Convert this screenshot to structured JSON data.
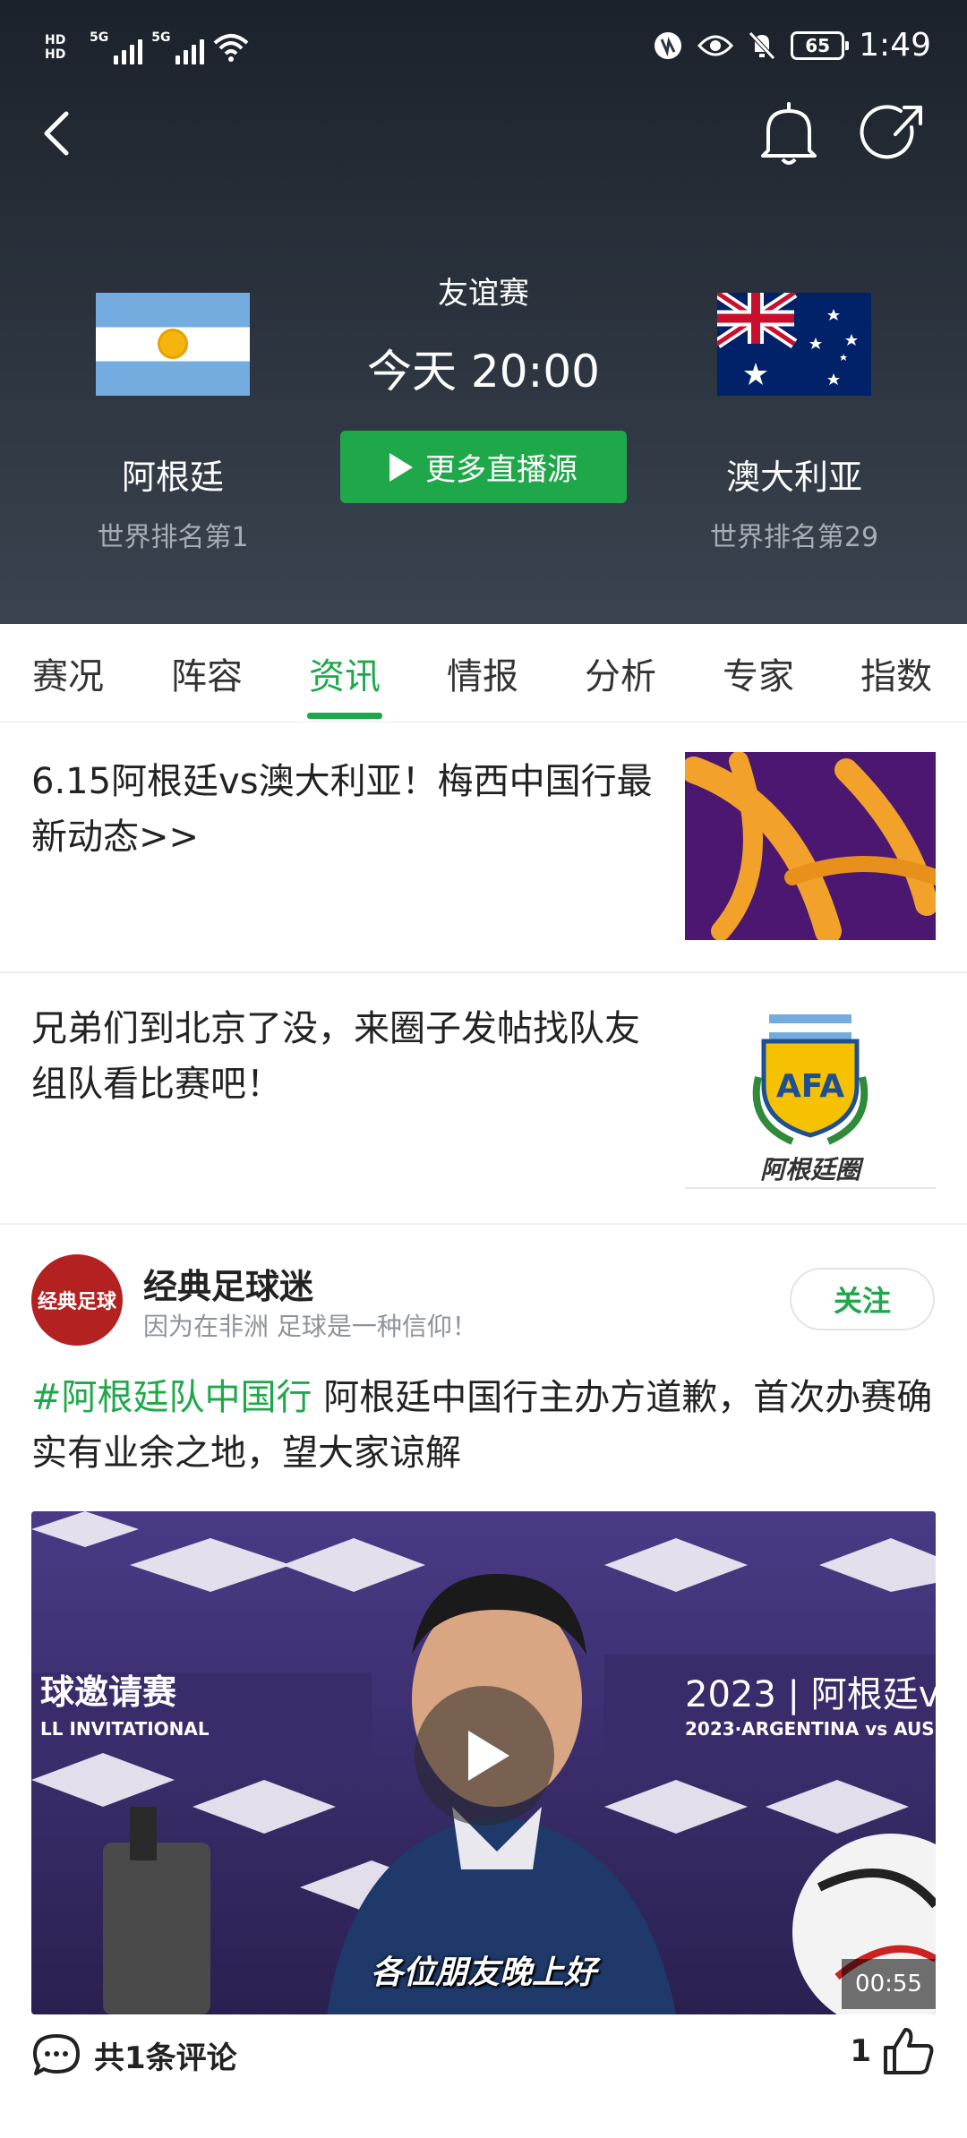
{
  "status_bar": {
    "hd1": "HD",
    "hd2": "HD",
    "net1": "5G",
    "net2": "5G",
    "battery": "65",
    "time": "1:49"
  },
  "match": {
    "type": "友谊赛",
    "time": "今天 20:00",
    "live_button": "更多直播源",
    "home": {
      "name": "阿根廷",
      "rank": "世界排名第1"
    },
    "away": {
      "name": "澳大利亚",
      "rank": "世界排名第29"
    }
  },
  "tabs": [
    {
      "label": "赛况"
    },
    {
      "label": "阵容"
    },
    {
      "label": "资讯",
      "active": true
    },
    {
      "label": "情报"
    },
    {
      "label": "分析"
    },
    {
      "label": "专家"
    },
    {
      "label": "指数"
    }
  ],
  "news": [
    {
      "title": "6.15阿根廷vs澳大利亚！梅西中国行最新动态>>"
    },
    {
      "title": "兄弟们到北京了没，来圈子发帖找队友组队看比赛吧！",
      "image_label": "阿根廷圈"
    }
  ],
  "post": {
    "avatar_text": "经典足球",
    "author": "经典足球迷",
    "subtitle": "因为在非洲 足球是一种信仰！",
    "follow": "关注",
    "hashtag": "#阿根廷队中国行",
    "text": " 阿根廷中国行主办方道歉，首次办赛确实有业余之地，望大家谅解",
    "video": {
      "caption": "各位朋友晚上好",
      "duration": "00:55",
      "backdrop_text_1": "球邀请赛",
      "backdrop_text_2": "LL INVITATIONAL",
      "backdrop_text_3": "2023 | 阿根廷v",
      "backdrop_text_4": "2023·ARGENTINA vs AUS"
    },
    "comments": "共1条评论",
    "likes": "1"
  },
  "colors": {
    "accent": "#1fa84a",
    "header_bg": "#2c343f"
  }
}
